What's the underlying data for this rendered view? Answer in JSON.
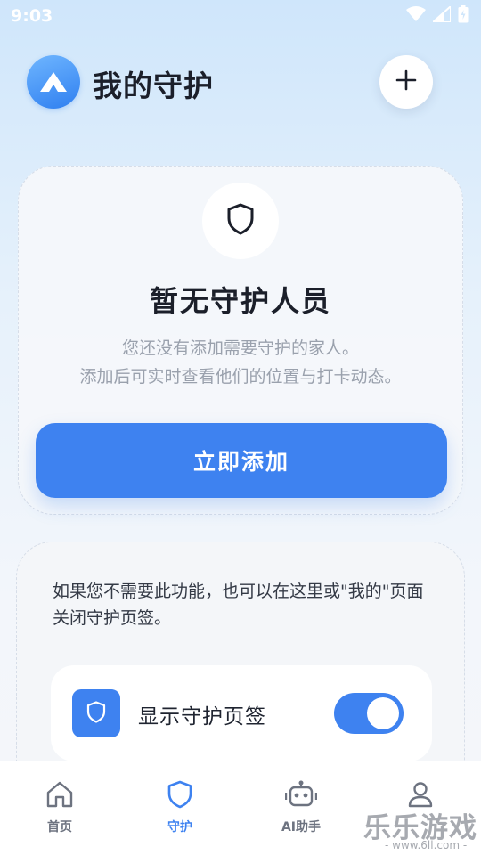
{
  "status_bar": {
    "time": "9:03",
    "icons": [
      "wifi-icon",
      "signal-icon",
      "battery-icon"
    ]
  },
  "header": {
    "title": "我的守护",
    "logo_icon": "app-logo-icon",
    "add_icon": "plus-icon"
  },
  "empty_state": {
    "icon": "shield-icon",
    "title": "暂无守护人员",
    "description_line1": "您还没有添加需要守护的家人。",
    "description_line2": "添加后可实时查看他们的位置与打卡动态。",
    "button_label": "立即添加"
  },
  "info": {
    "text": "如果您不需要此功能，也可以在这里或\"我的\"页面关闭守护页签。",
    "toggle_label": "显示守护页签",
    "toggle_on": true,
    "toggle_icon": "shield-icon"
  },
  "bottom_nav": {
    "items": [
      {
        "label": "首页",
        "icon": "home-icon",
        "active": false
      },
      {
        "label": "守护",
        "icon": "shield-icon",
        "active": true
      },
      {
        "label": "AI助手",
        "icon": "robot-icon",
        "active": false
      },
      {
        "label": "",
        "icon": "user-icon",
        "active": false
      }
    ]
  },
  "watermark": {
    "main": "乐乐游戏",
    "sub": "- www.6ll.com -"
  },
  "colors": {
    "accent": "#3e82f0",
    "title": "#1b1f2a",
    "muted": "#9aa1ad"
  }
}
